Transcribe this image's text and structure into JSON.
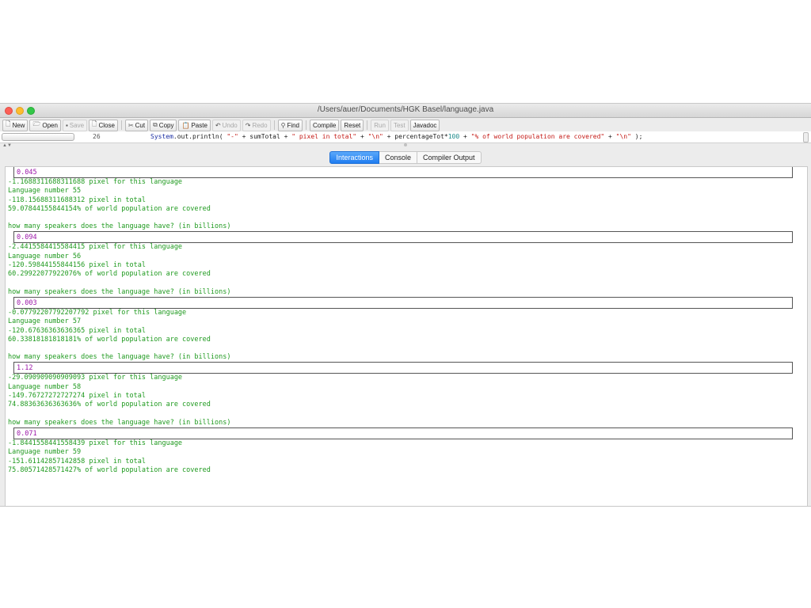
{
  "window": {
    "title": "/Users/auer/Documents/HGK Basel/language.java"
  },
  "toolbar": {
    "new_label": "New",
    "open_label": "Open",
    "save_label": "Save",
    "close_label": "Close",
    "cut_label": "Cut",
    "copy_label": "Copy",
    "paste_label": "Paste",
    "undo_label": "Undo",
    "redo_label": "Redo",
    "find_label": "Find",
    "compile_label": "Compile",
    "reset_label": "Reset",
    "run_label": "Run",
    "test_label": "Test",
    "javadoc_label": "Javadoc"
  },
  "editor": {
    "line_number": "26",
    "code_parts": {
      "p1": "System",
      "p2": ".out.println( ",
      "p3": "\"-\"",
      "p4": " + sumTotal + ",
      "p5": "\" pixel in total\"",
      "p6": " + ",
      "p7": "\"\\n\"",
      "p8": " + percentageTot*",
      "p9": "100",
      "p10": " + ",
      "p11": "\"% of world population are covered\"",
      "p12": " + ",
      "p13": "\"\\n\"",
      "p14": " );"
    }
  },
  "tabs": {
    "interactions": "Interactions",
    "console": "Console",
    "compiler_output": "Compiler Output"
  },
  "console": {
    "prompt": "how many speakers does the language have? (in billions)",
    "entries": [
      {
        "input": "0.045",
        "lines": [
          "-1.1688311688311688 pixel for this language",
          "Language number 55",
          "-118.15688311688312 pixel in total",
          "59.07844155844154% of world population are covered"
        ]
      },
      {
        "input": "0.094",
        "lines": [
          "-2.4415584415584415 pixel for this language",
          "Language number 56",
          "-120.59844155844156 pixel in total",
          "60.29922077922076% of world population are covered"
        ]
      },
      {
        "input": "0.003",
        "lines": [
          "-0.07792207792207792 pixel for this language",
          "Language number 57",
          "-120.67636363636365 pixel in total",
          "60.33818181818181% of world population are covered"
        ]
      },
      {
        "input": "1.12",
        "lines": [
          "-29.090909090909093 pixel for this language",
          "Language number 58",
          "-149.76727272727274 pixel in total",
          "74.88363636363636% of world population are covered"
        ]
      },
      {
        "input": "0.071",
        "lines": [
          "-1.8441558441558439 pixel for this language",
          "Language number 59",
          "-151.61142857142858 pixel in total",
          "75.80571428571427% of world population are covered"
        ]
      }
    ]
  }
}
